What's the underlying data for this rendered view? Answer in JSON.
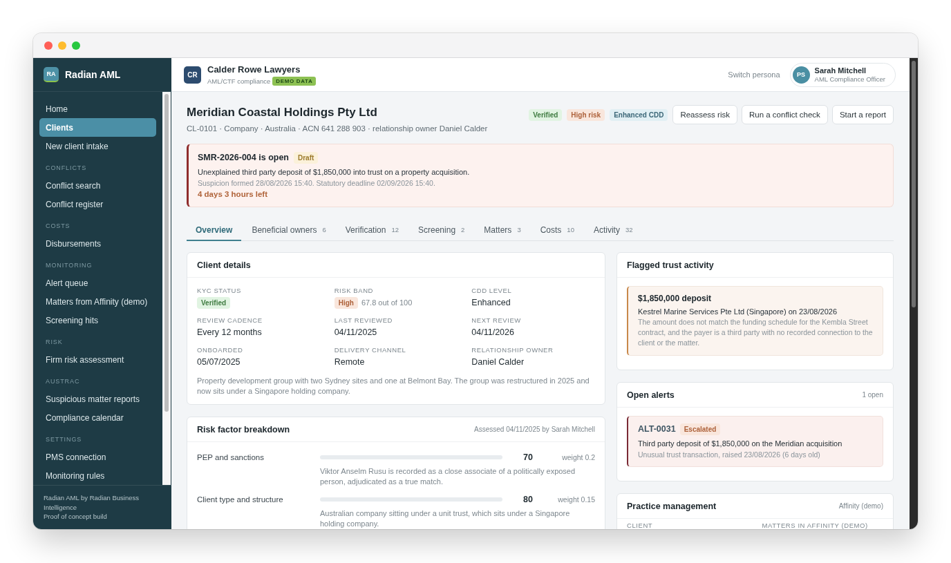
{
  "sidebar": {
    "logo": "RA",
    "app_name": "Radian AML",
    "sections": [
      {
        "items": [
          {
            "label": "Home",
            "selected": false
          },
          {
            "label": "Clients",
            "selected": true
          },
          {
            "label": "New client intake",
            "selected": false
          }
        ]
      },
      {
        "heading": "CONFLICTS",
        "items": [
          {
            "label": "Conflict search",
            "selected": false
          },
          {
            "label": "Conflict register",
            "selected": false
          }
        ]
      },
      {
        "heading": "COSTS",
        "items": [
          {
            "label": "Disbursements",
            "selected": false
          }
        ]
      },
      {
        "heading": "MONITORING",
        "items": [
          {
            "label": "Alert queue",
            "selected": false
          },
          {
            "label": "Matters from Affinity (demo)",
            "selected": false
          },
          {
            "label": "Screening hits",
            "selected": false
          }
        ]
      },
      {
        "heading": "RISK",
        "items": [
          {
            "label": "Firm risk assessment",
            "selected": false
          }
        ]
      },
      {
        "heading": "AUSTRAC",
        "items": [
          {
            "label": "Suspicious matter reports",
            "selected": false
          },
          {
            "label": "Compliance calendar",
            "selected": false
          }
        ]
      },
      {
        "heading": "SETTINGS",
        "items": [
          {
            "label": "PMS connection",
            "selected": false
          },
          {
            "label": "Monitoring rules",
            "selected": false
          }
        ]
      }
    ],
    "footer": [
      "Radian AML by Radian Business Intelligence",
      "Proof of concept build"
    ]
  },
  "topbar": {
    "org_initials": "CR",
    "org_name": "Calder Rowe Lawyers",
    "org_subtitle": "AML/CTF compliance",
    "demo_badge": "DEMO DATA",
    "switch_persona": "Switch persona",
    "user": {
      "initials": "PS",
      "name": "Sarah Mitchell",
      "role": "AML Compliance Officer"
    }
  },
  "client": {
    "name": "Meridian Coastal Holdings Pty Ltd",
    "meta": "CL-0101 · Company · Australia · ACN 641 288 903 · relationship owner Daniel Calder",
    "badges": [
      {
        "label": "Verified",
        "color": "#3d7a3f"
      },
      {
        "label": "High risk",
        "color": "#ad613a"
      },
      {
        "label": "Enhanced CDD",
        "color": "#3b6677"
      }
    ],
    "actions": [
      "Reassess risk",
      "Run a conflict check",
      "Start a report"
    ]
  },
  "smr_alert": {
    "title": "SMR-2026-004 is open",
    "status": "Draft",
    "color": "#9c7a2b",
    "description": "Unexplained third party deposit of $1,850,000 into trust on a property acquisition.",
    "dates": "Suspicion formed 28/08/2026 15:40. Statutory deadline 02/09/2026 15:40.",
    "countdown": "4 days 3 hours left"
  },
  "tabs": [
    {
      "label": "Overview",
      "selected": true
    },
    {
      "label": "Beneficial owners",
      "count": "6",
      "selected": false
    },
    {
      "label": "Verification",
      "count": "12",
      "selected": false
    },
    {
      "label": "Screening",
      "count": "2",
      "selected": false
    },
    {
      "label": "Matters",
      "count": "3",
      "selected": false
    },
    {
      "label": "Costs",
      "count": "10",
      "selected": false
    },
    {
      "label": "Activity",
      "count": "32",
      "selected": false
    }
  ],
  "client_details": {
    "title": "Client details",
    "fields": [
      {
        "label": "KYC STATUS",
        "kind": "badge",
        "value": "Verified",
        "color": "#3d7a3f"
      },
      {
        "label": "RISK BAND",
        "kind": "badge",
        "value": "High",
        "color": "#ad613a",
        "note": "67.8 out of 100"
      },
      {
        "label": "CDD LEVEL",
        "kind": "text",
        "value": "Enhanced"
      },
      {
        "label": "REVIEW CADENCE",
        "kind": "text",
        "value": "Every 12 months"
      },
      {
        "label": "LAST REVIEWED",
        "kind": "text",
        "value": "04/11/2025"
      },
      {
        "label": "NEXT REVIEW",
        "kind": "text",
        "value": "04/11/2026"
      },
      {
        "label": "ONBOARDED",
        "kind": "text",
        "value": "05/07/2025"
      },
      {
        "label": "DELIVERY CHANNEL",
        "kind": "text",
        "value": "Remote"
      },
      {
        "label": "RELATIONSHIP OWNER",
        "kind": "text",
        "value": "Daniel Calder"
      }
    ],
    "description": "Property development group with two Sydney sites and one at Belmont Bay. The group was restructured in 2025 and now sits under a Singapore holding company."
  },
  "risk_factors": {
    "title": "Risk factor breakdown",
    "assessed": "Assessed 04/11/2025 by Sarah Mitchell",
    "rows": [
      {
        "label": "PEP and sanctions",
        "score": "70",
        "weight": "weight 0.2",
        "description": "Viktor Anselm Rusu is recorded as a close associate of a politically exposed person, adjudicated as a true match."
      },
      {
        "label": "Client type and structure",
        "score": "80",
        "weight": "weight 0.15",
        "description": "Australian company sitting under a unit trust, which sits under a Singapore holding company."
      }
    ]
  },
  "flagged_trust_activity": {
    "title": "Flagged trust activity",
    "items": [
      {
        "amount": "$1,850,000 deposit",
        "payer": "Kestrel Marine Services Pte Ltd (Singapore) on 23/08/2026",
        "description": "The amount does not match the funding schedule for the Kembla Street contract, and the payer is a third party with no recorded connection to the client or the matter."
      }
    ]
  },
  "open_alerts": {
    "title": "Open alerts",
    "count": "1 open",
    "alerts": [
      {
        "id": "ALT-0031",
        "status": "Escalated",
        "color": "#ad613a",
        "title": "Third party deposit of $1,850,000 on the Meridian acquisition",
        "meta": "Unusual trust transaction, raised 23/08/2026 (6 days old)"
      }
    ]
  },
  "practice_management": {
    "title": "Practice management",
    "source": "Affinity (demo)",
    "columns": [
      "CLIENT",
      "MATTERS IN AFFINITY (DEMO)"
    ]
  }
}
